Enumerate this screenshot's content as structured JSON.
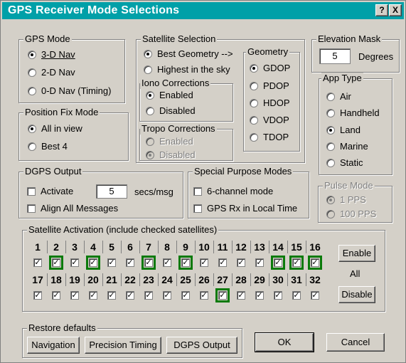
{
  "window": {
    "title": "GPS Receiver Mode Selections",
    "help_glyph": "?",
    "close_glyph": "X"
  },
  "gps_mode": {
    "legend": "GPS Mode",
    "options": [
      {
        "label": "3-D Nav",
        "checked": true
      },
      {
        "label": "2-D Nav",
        "checked": false
      },
      {
        "label": "0-D Nav (Timing)",
        "checked": false
      }
    ]
  },
  "position_fix": {
    "legend": "Position Fix Mode",
    "options": [
      {
        "label": "All in view",
        "checked": true
      },
      {
        "label": "Best 4",
        "checked": false
      }
    ]
  },
  "satellite_selection": {
    "legend": "Satellite Selection",
    "options": [
      {
        "label": "Best Geometry -->",
        "checked": true
      },
      {
        "label": "Highest in the sky",
        "checked": false
      }
    ]
  },
  "iono": {
    "legend": "Iono Corrections",
    "options": [
      {
        "label": "Enabled",
        "checked": true
      },
      {
        "label": "Disabled",
        "checked": false
      }
    ]
  },
  "tropo": {
    "legend": "Tropo Corrections",
    "options": [
      {
        "label": "Enabled",
        "checked": false
      },
      {
        "label": "Disabled",
        "checked": true
      }
    ]
  },
  "geometry": {
    "legend": "Geometry",
    "options": [
      {
        "label": "GDOP",
        "checked": true
      },
      {
        "label": "PDOP",
        "checked": false
      },
      {
        "label": "HDOP",
        "checked": false
      },
      {
        "label": "VDOP",
        "checked": false
      },
      {
        "label": "TDOP",
        "checked": false
      }
    ]
  },
  "elevation": {
    "legend": "Elevation Mask",
    "value": "5",
    "unit": "Degrees"
  },
  "app_type": {
    "legend": "App Type",
    "options": [
      {
        "label": "Air",
        "checked": false
      },
      {
        "label": "Handheld",
        "checked": false
      },
      {
        "label": "Land",
        "checked": true
      },
      {
        "label": "Marine",
        "checked": false
      },
      {
        "label": "Static",
        "checked": false
      }
    ]
  },
  "dgps": {
    "legend": "DGPS Output",
    "activate": "Activate",
    "value": "5",
    "unit": "secs/msg",
    "align": "Align All Messages"
  },
  "special": {
    "legend": "Special Purpose Modes",
    "six_channel": "6-channel mode",
    "local_time": "GPS Rx in Local Time"
  },
  "pulse": {
    "legend": "Pulse Mode",
    "options": [
      {
        "label": "1 PPS",
        "checked": true
      },
      {
        "label": "100 PPS",
        "checked": false
      }
    ]
  },
  "satellites": {
    "legend": "Satellite Activation (include checked satellites)",
    "check_glyph": "✓",
    "row1": [
      "1",
      "2",
      "3",
      "4",
      "5",
      "6",
      "7",
      "8",
      "9",
      "10",
      "11",
      "12",
      "13",
      "14",
      "15",
      "16"
    ],
    "row2": [
      "17",
      "18",
      "19",
      "20",
      "21",
      "22",
      "23",
      "24",
      "25",
      "26",
      "27",
      "28",
      "29",
      "30",
      "31",
      "32"
    ],
    "highlighted": [
      "2",
      "4",
      "7",
      "9",
      "14",
      "15",
      "16",
      "27"
    ],
    "enable": "Enable",
    "all": "All",
    "disable": "Disable"
  },
  "restore": {
    "legend": "Restore defaults",
    "navigation": "Navigation",
    "precision": "Precision Timing",
    "dgps": "DGPS Output"
  },
  "buttons": {
    "ok": "OK",
    "cancel": "Cancel"
  }
}
